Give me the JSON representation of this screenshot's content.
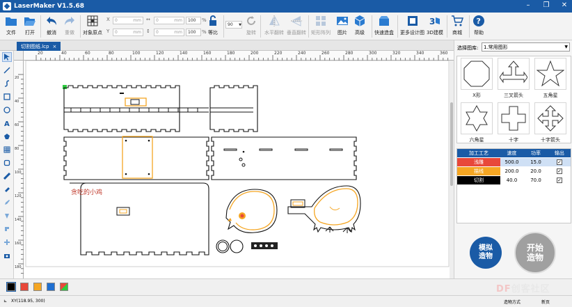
{
  "app": {
    "title": "LaserMaker V1.5.68"
  },
  "window_controls": {
    "minimize": "–",
    "restore": "❐",
    "close": "✕"
  },
  "ribbon": {
    "file": "文件",
    "open": "打开",
    "undo": "撤消",
    "redo": "重做",
    "origin": "对象原点",
    "x_value": "0",
    "y_value": "0",
    "w_value": "0",
    "h_value": "0",
    "unit": "mm",
    "pct": "100",
    "pct_sign": "%",
    "ratio": "等比",
    "angle": "90",
    "rotate": "旋转",
    "hflip": "水平翻转",
    "vflip": "垂直翻转",
    "array": "矩形阵列",
    "image": "图片",
    "advanced": "高级",
    "quick_box": "快速造盒",
    "more_designs": "更多设计图",
    "modeling_3d": "3D建模",
    "store": "商城",
    "help": "帮助"
  },
  "tab": {
    "label": "切割图纸.lcp",
    "close": "×"
  },
  "ruler": {
    "top": [
      "20",
      "40",
      "60",
      "80",
      "100",
      "120",
      "140",
      "160",
      "180",
      "200",
      "220",
      "240",
      "260",
      "280",
      "300",
      "320",
      "340",
      "360"
    ],
    "left": [
      "20",
      "40",
      "60",
      "80",
      "100",
      "120",
      "140",
      "160",
      "180"
    ]
  },
  "canvas": {
    "engrave_text": "贪吃的小鸡"
  },
  "library": {
    "label": "选择图库:",
    "selected": "1.常用图形",
    "shapes": [
      "X形",
      "三叉箭头",
      "五角星",
      "六角星",
      "十字",
      "十字箭头"
    ]
  },
  "process_table": {
    "headers": [
      "加工工艺",
      "速度",
      "功率",
      "输出"
    ],
    "rows": [
      {
        "name": "浅雕",
        "speed": "500.0",
        "power": "15.0",
        "color": "#e8483a",
        "checked": "✓"
      },
      {
        "name": "描线",
        "speed": "200.0",
        "power": "20.0",
        "color": "#f5a623",
        "checked": "✓"
      },
      {
        "name": "切割",
        "speed": "40.0",
        "power": "70.0",
        "color": "#000000",
        "checked": "✓"
      }
    ]
  },
  "buttons": {
    "sim_l1": "模拟",
    "sim_l2": "造物",
    "start_l1": "开始",
    "start_l2": "造物"
  },
  "palette": [
    "#000000",
    "#e8483a",
    "#f5a623",
    "#1f6fd1",
    "multi"
  ],
  "status": {
    "coords": "XY(118.95, 300)",
    "mode": "造物方式",
    "new": "新页"
  },
  "watermark": {
    "df": "DF",
    "text": "创客社区"
  }
}
